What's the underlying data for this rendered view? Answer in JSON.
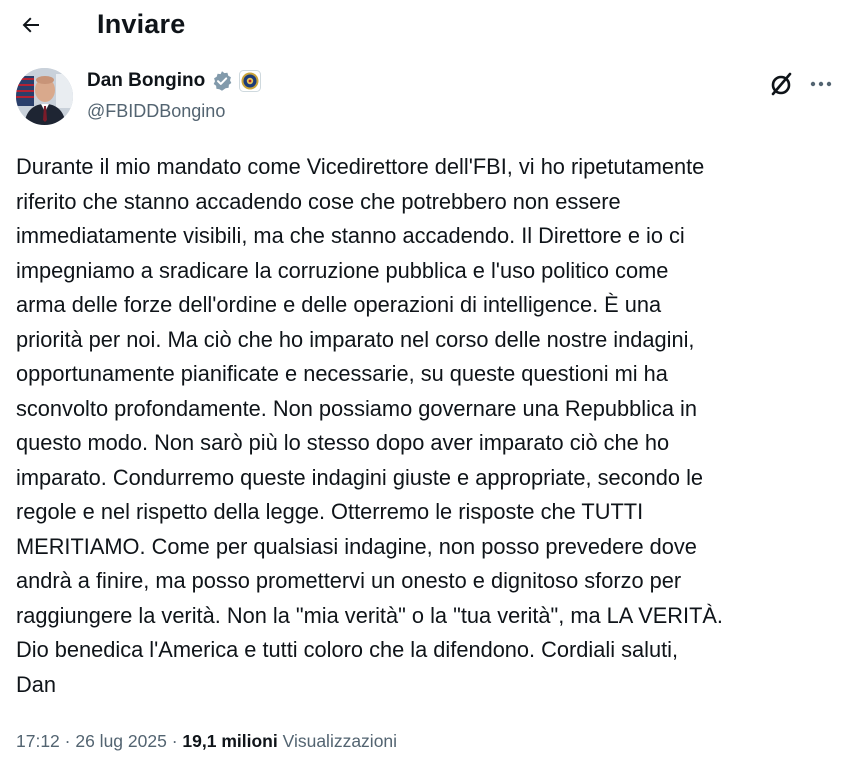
{
  "header": {
    "title": "Inviare",
    "back_icon": "arrow-left-icon"
  },
  "author": {
    "display_name": "Dan Bongino",
    "handle": "@FBIDDBongino",
    "verified_color": "#829aab",
    "badge": "fbi-seal-icon"
  },
  "tweet": {
    "text": "Durante il mio mandato come Vicedirettore dell'FBI, vi ho ripetutamente\nriferito che stanno accadendo cose che potrebbero non essere\nimmediatamente visibili, ma che stanno accadendo. Il Direttore e io ci\nimpegniamo a sradicare la corruzione pubblica e l'uso politico come\narma delle forze dell'ordine e delle operazioni di intelligence. È una\npriorità per noi. Ma ciò che ho imparato nel corso delle nostre indagini,\nopportunamente pianificate e necessarie, su queste questioni mi ha\nsconvolto profondamente. Non possiamo governare una Repubblica in\nquesto modo. Non sarò più lo stesso dopo aver imparato ciò che ho\nimparato. Condurremo queste indagini giuste e appropriate, secondo le\nregole e nel rispetto della legge. Otterremo le risposte che TUTTI\nMERITIAMO. Come per qualsiasi indagine, non posso prevedere dove\nandrà a finire, ma posso promettervi un onesto e dignitoso sforzo per\nraggiungere la verità. Non la \"mia verità\" o la \"tua verità\", ma LA VERITÀ.\nDio benedica l'America e tutti coloro che la difendono. Cordiali saluti,\nDan"
  },
  "meta": {
    "time": "17:12",
    "separator": " · ",
    "date": "26 lug 2025",
    "views_count": "19,1 milioni",
    "views_label": "Visualizzazioni"
  }
}
